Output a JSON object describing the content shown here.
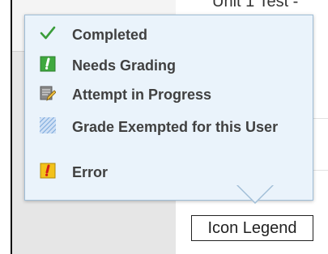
{
  "page": {
    "partial_heading": "Unit 1 Test -"
  },
  "legend": {
    "items": [
      {
        "label": "Completed",
        "icon": "checkmark-icon",
        "color": "#3a9d3a"
      },
      {
        "label": "Needs Grading",
        "icon": "exclamation-green-icon",
        "color": "#3fa93f"
      },
      {
        "label": "Attempt in Progress",
        "icon": "pencil-document-icon",
        "color": "#7a7a7a"
      },
      {
        "label": "Grade Exempted for this User",
        "icon": "hatched-square-icon",
        "color": "#8fb7e3"
      },
      {
        "label": "Error",
        "icon": "exclamation-yellow-icon",
        "color": "#f3c21a"
      }
    ]
  },
  "button": {
    "label": "Icon Legend"
  }
}
